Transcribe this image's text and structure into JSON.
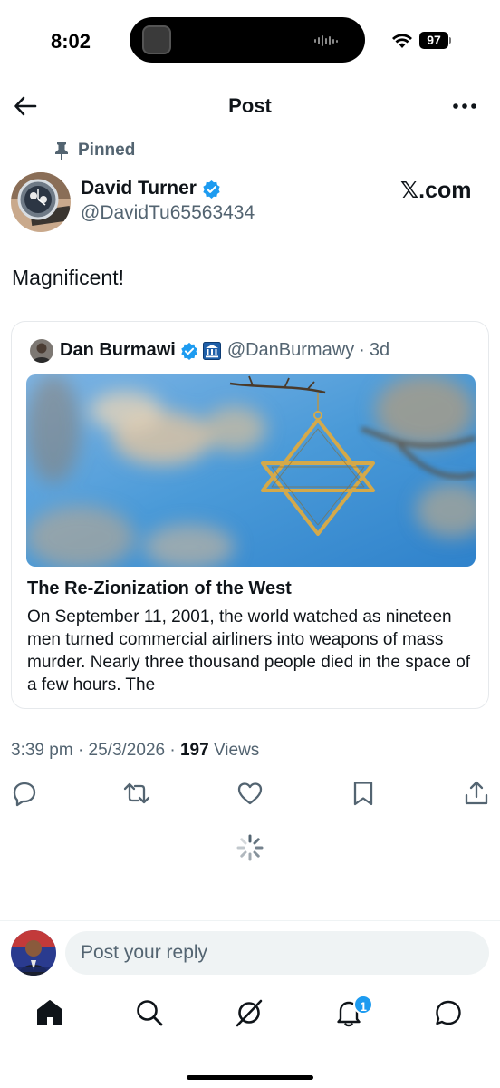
{
  "status_bar": {
    "time": "8:02",
    "battery": "97"
  },
  "header": {
    "title": "Post"
  },
  "post": {
    "pinned_label": "Pinned",
    "author_name": "David Turner",
    "author_handle": "@DavidTu65563434",
    "source_label": "𝕏.com",
    "text": "Magnificent!",
    "time": "3:39 pm",
    "date": "25/3/2026",
    "views_count": "197",
    "views_label": "Views"
  },
  "quote": {
    "author_name": "Dan Burmawi",
    "author_handle": "@DanBurmawy",
    "age": "3d",
    "article_title": "The Re-Zionization of the West",
    "article_excerpt": "On September 11, 2001, the world watched as nineteen men turned commercial airliners into weapons of mass murder. Nearly three thousand people died in the space of a few hours. The"
  },
  "reply": {
    "placeholder": "Post your reply"
  },
  "tabbar": {
    "notifications_badge": "1"
  },
  "colors": {
    "accent": "#1d9bf0",
    "text": "#0f1419",
    "secondary": "#536471",
    "image_sky": "#4a9ad8",
    "star_gold": "#d4a94a"
  },
  "icons": [
    "back-arrow-icon",
    "more-dots-icon",
    "pin-icon",
    "verified-badge-icon",
    "gov-building-icon",
    "reply-icon",
    "repost-icon",
    "like-heart-icon",
    "bookmark-icon",
    "share-icon",
    "loading-spinner-icon",
    "home-icon",
    "search-icon",
    "grok-icon",
    "notifications-bell-icon",
    "messages-icon"
  ]
}
